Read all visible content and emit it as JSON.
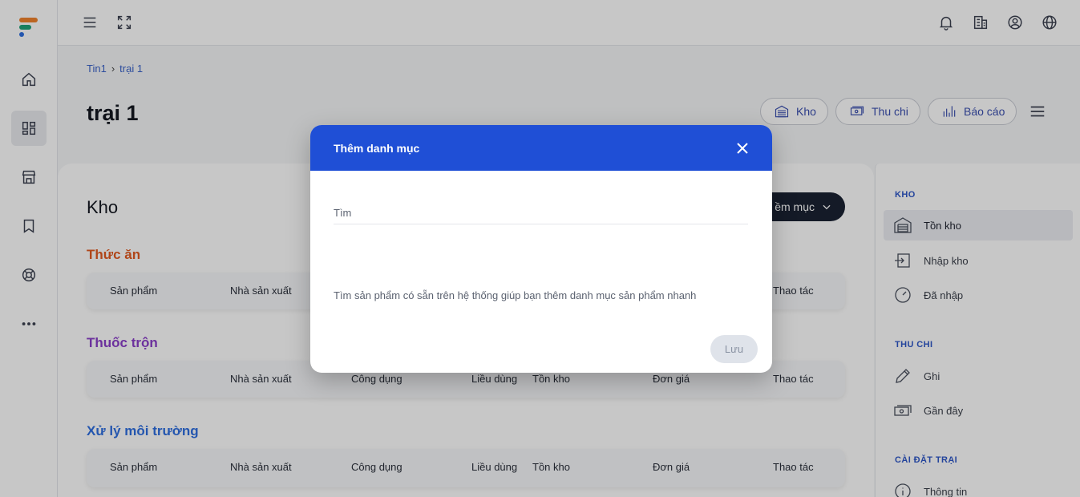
{
  "topbar": {
    "icons": [
      "menu-icon",
      "fullscreen-icon",
      "bell-icon",
      "building-icon",
      "user-circle-icon",
      "globe-icon"
    ]
  },
  "rail": {
    "icons": [
      "home-icon",
      "dashboard-icon",
      "store-icon",
      "bookmark-icon",
      "lifebuoy-icon",
      "more-icon"
    ]
  },
  "breadcrumb": {
    "root": "Tin1",
    "current": "trại 1"
  },
  "page": {
    "title": "trại 1"
  },
  "header_buttons": {
    "kho": "Kho",
    "thu_chi": "Thu chi",
    "bao_cao": "Báo cáo"
  },
  "main": {
    "title": "Kho",
    "add_button": "ềm mục",
    "sections": [
      {
        "title": "Thức ăn",
        "color": "#e25a20",
        "columns": [
          "Sản phẩm",
          "Nhà sản xuất",
          "Thao tác"
        ]
      },
      {
        "title": "Thuốc trộn",
        "color": "#8b3fc9",
        "columns": [
          "Sản phẩm",
          "Nhà sản xuất",
          "Công dụng",
          "Liều dùng",
          "Tồn kho",
          "Đơn giá",
          "Thao tác"
        ]
      },
      {
        "title": "Xử lý môi trường",
        "color": "#2f6fe0",
        "columns": [
          "Sản phẩm",
          "Nhà sản xuất",
          "Công dụng",
          "Liều dùng",
          "Tồn kho",
          "Đơn giá",
          "Thao tác"
        ]
      }
    ]
  },
  "right_panel": {
    "kho": {
      "title": "KHO",
      "items": [
        "Tồn kho",
        "Nhập kho",
        "Đã nhập"
      ]
    },
    "thu_chi": {
      "title": "THU CHI",
      "items": [
        "Ghi",
        "Gần đây"
      ]
    },
    "cai_dat": {
      "title": "CÀI ĐẶT TRẠI",
      "items": [
        "Thông tin"
      ]
    }
  },
  "dialog": {
    "title": "Thêm danh mục",
    "search_placeholder": "Tìm",
    "hint": "Tìm sản phẩm có sẵn trên hệ thống giúp bạn thêm danh mục sản phẩm nhanh",
    "save_label": "Lưu"
  },
  "colors": {
    "accent": "#1f4fd6",
    "dark_button": "#1a2233",
    "link": "#3a63c9"
  }
}
